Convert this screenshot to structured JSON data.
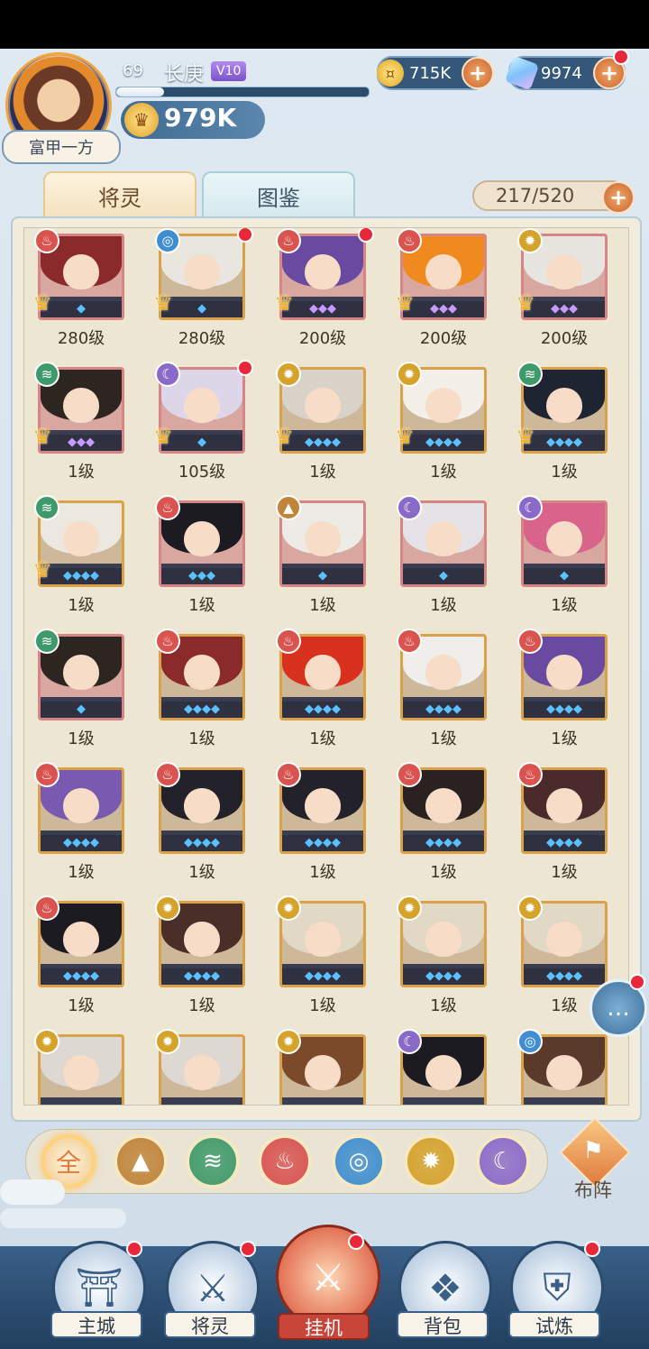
{
  "player": {
    "level": "69",
    "name": "长庚",
    "vip": "V10",
    "title": "富甲一方",
    "exp_progress": 0.19,
    "power": "979K"
  },
  "resources": {
    "gold": "715K",
    "gems": "9974"
  },
  "tabs": [
    {
      "label": "将灵",
      "active": true
    },
    {
      "label": "图鉴",
      "active": false
    }
  ],
  "capacity": "217/520",
  "heroes": [
    {
      "element": "fire",
      "level": "280级",
      "awakened": true,
      "red_dot": false,
      "frame": "red",
      "stars": "◆",
      "hair": "#8b2a2a"
    },
    {
      "element": "water",
      "level": "280级",
      "awakened": true,
      "red_dot": true,
      "frame": "gold",
      "stars": "◆",
      "hair": "#e9e6e0"
    },
    {
      "element": "fire",
      "level": "200级",
      "awakened": true,
      "red_dot": true,
      "frame": "red",
      "stars": "◆◆◆",
      "hair": "#6a4aa0"
    },
    {
      "element": "fire",
      "level": "200级",
      "awakened": true,
      "red_dot": false,
      "frame": "red",
      "stars": "◆◆◆",
      "hair": "#f08a1e"
    },
    {
      "element": "light",
      "level": "200级",
      "awakened": true,
      "red_dot": false,
      "frame": "red",
      "stars": "◆◆◆",
      "hair": "#e8e4df"
    },
    {
      "element": "wind",
      "level": "1级",
      "awakened": true,
      "red_dot": false,
      "frame": "red",
      "stars": "◆◆◆",
      "hair": "#2d2620"
    },
    {
      "element": "dark",
      "level": "105级",
      "awakened": true,
      "red_dot": true,
      "frame": "red",
      "stars": "◆",
      "hair": "#dcd6e8"
    },
    {
      "element": "light",
      "level": "1级",
      "awakened": true,
      "red_dot": false,
      "frame": "gold",
      "stars": "◆◆◆◆",
      "hair": "#d9d2c8"
    },
    {
      "element": "light",
      "level": "1级",
      "awakened": true,
      "red_dot": false,
      "frame": "gold",
      "stars": "◆◆◆◆",
      "hair": "#f4efe9"
    },
    {
      "element": "wind",
      "level": "1级",
      "awakened": true,
      "red_dot": false,
      "frame": "gold",
      "stars": "◆◆◆◆",
      "hair": "#1f2433"
    },
    {
      "element": "wind",
      "level": "1级",
      "awakened": true,
      "red_dot": false,
      "frame": "gold",
      "stars": "◆◆◆◆",
      "hair": "#ece8e0"
    },
    {
      "element": "fire",
      "level": "1级",
      "awakened": false,
      "red_dot": false,
      "frame": "red",
      "stars": "◆◆◆",
      "hair": "#1d1b22"
    },
    {
      "element": "mountain",
      "level": "1级",
      "awakened": false,
      "red_dot": false,
      "frame": "red",
      "stars": "◆",
      "hair": "#ecebe6"
    },
    {
      "element": "dark",
      "level": "1级",
      "awakened": false,
      "red_dot": false,
      "frame": "red",
      "stars": "◆",
      "hair": "#e6e3e8"
    },
    {
      "element": "dark",
      "level": "1级",
      "awakened": false,
      "red_dot": false,
      "frame": "red",
      "stars": "◆",
      "hair": "#d8648c"
    },
    {
      "element": "wind",
      "level": "1级",
      "awakened": false,
      "red_dot": false,
      "frame": "red",
      "stars": "◆",
      "hair": "#2d2620"
    },
    {
      "element": "fire",
      "level": "1级",
      "awakened": false,
      "red_dot": false,
      "frame": "gold",
      "stars": "◆◆◆◆",
      "hair": "#8b2a2a"
    },
    {
      "element": "fire",
      "level": "1级",
      "awakened": false,
      "red_dot": false,
      "frame": "gold",
      "stars": "◆◆◆◆",
      "hair": "#d8321e"
    },
    {
      "element": "fire",
      "level": "1级",
      "awakened": false,
      "red_dot": false,
      "frame": "gold",
      "stars": "◆◆◆◆",
      "hair": "#efeeea"
    },
    {
      "element": "fire",
      "level": "1级",
      "awakened": false,
      "red_dot": false,
      "frame": "gold",
      "stars": "◆◆◆◆",
      "hair": "#6a4aa0"
    },
    {
      "element": "fire",
      "level": "1级",
      "awakened": false,
      "red_dot": false,
      "frame": "gold",
      "stars": "◆◆◆◆",
      "hair": "#7a5ab0"
    },
    {
      "element": "fire",
      "level": "1级",
      "awakened": false,
      "red_dot": false,
      "frame": "gold",
      "stars": "◆◆◆◆",
      "hair": "#23222a"
    },
    {
      "element": "fire",
      "level": "1级",
      "awakened": false,
      "red_dot": false,
      "frame": "gold",
      "stars": "◆◆◆◆",
      "hair": "#23222a"
    },
    {
      "element": "fire",
      "level": "1级",
      "awakened": false,
      "red_dot": false,
      "frame": "gold",
      "stars": "◆◆◆◆",
      "hair": "#2a2220"
    },
    {
      "element": "fire",
      "level": "1级",
      "awakened": false,
      "red_dot": false,
      "frame": "gold",
      "stars": "◆◆◆◆",
      "hair": "#4a2a2a"
    },
    {
      "element": "fire",
      "level": "1级",
      "awakened": false,
      "red_dot": false,
      "frame": "gold",
      "stars": "◆◆◆◆",
      "hair": "#1d1b22"
    },
    {
      "element": "light",
      "level": "1级",
      "awakened": false,
      "red_dot": false,
      "frame": "gold",
      "stars": "◆◆◆◆",
      "hair": "#4a2e28"
    },
    {
      "element": "light",
      "level": "1级",
      "awakened": false,
      "red_dot": false,
      "frame": "gold",
      "stars": "◆◆◆◆",
      "hair": "#e2d8c6"
    },
    {
      "element": "light",
      "level": "1级",
      "awakened": false,
      "red_dot": false,
      "frame": "gold",
      "stars": "◆◆◆◆",
      "hair": "#e2d8c6"
    },
    {
      "element": "light",
      "level": "1级",
      "awakened": false,
      "red_dot": false,
      "frame": "gold",
      "stars": "◆◆◆◆",
      "hair": "#e2d8c6"
    },
    {
      "element": "light",
      "level": "",
      "awakened": false,
      "red_dot": false,
      "frame": "gold",
      "stars": "",
      "hair": "#ddd8d2"
    },
    {
      "element": "light",
      "level": "",
      "awakened": false,
      "red_dot": false,
      "frame": "gold",
      "stars": "",
      "hair": "#ddd8d2"
    },
    {
      "element": "light",
      "level": "",
      "awakened": false,
      "red_dot": false,
      "frame": "gold",
      "stars": "",
      "hair": "#7a4a2a"
    },
    {
      "element": "dark",
      "level": "",
      "awakened": false,
      "red_dot": false,
      "frame": "gold",
      "stars": "",
      "hair": "#1d1b22"
    },
    {
      "element": "water",
      "level": "",
      "awakened": false,
      "red_dot": false,
      "frame": "gold",
      "stars": "",
      "hair": "#5a3a2a"
    }
  ],
  "element_styles": {
    "fire": {
      "color": "#d9534f",
      "glyph": "♨"
    },
    "water": {
      "color": "#3f8fd0",
      "glyph": "◎"
    },
    "wind": {
      "color": "#3e9a6a",
      "glyph": "≋"
    },
    "light": {
      "color": "#d5a22a",
      "glyph": "✹"
    },
    "dark": {
      "color": "#8a6ac8",
      "glyph": "☾"
    },
    "mountain": {
      "color": "#c0843a",
      "glyph": "▲"
    }
  },
  "filters": [
    {
      "name": "all",
      "label": "全",
      "color": "#f0c98a"
    },
    {
      "name": "mountain",
      "label": "▲",
      "color": "#c0843a"
    },
    {
      "name": "wind",
      "label": "≋",
      "color": "#3e9a6a"
    },
    {
      "name": "fire",
      "label": "♨",
      "color": "#d9534f"
    },
    {
      "name": "water",
      "label": "◎",
      "color": "#3f8fd0"
    },
    {
      "name": "light",
      "label": "✹",
      "color": "#d5a22a"
    },
    {
      "name": "dark",
      "label": "☾",
      "color": "#8a6ac8"
    }
  ],
  "formation_label": "布阵",
  "nav": [
    {
      "label": "主城",
      "icon": "castle-icon",
      "glyph": "⛩",
      "red_dot": true
    },
    {
      "label": "将灵",
      "icon": "helmet-icon",
      "glyph": "⚔",
      "red_dot": true
    },
    {
      "label": "挂机",
      "icon": "swords-icon",
      "glyph": "⚔",
      "red_dot": true,
      "center": true
    },
    {
      "label": "背包",
      "icon": "bag-icon",
      "glyph": "❖",
      "red_dot": false
    },
    {
      "label": "试炼",
      "icon": "shield-icon",
      "glyph": "⛨",
      "red_dot": true
    }
  ]
}
